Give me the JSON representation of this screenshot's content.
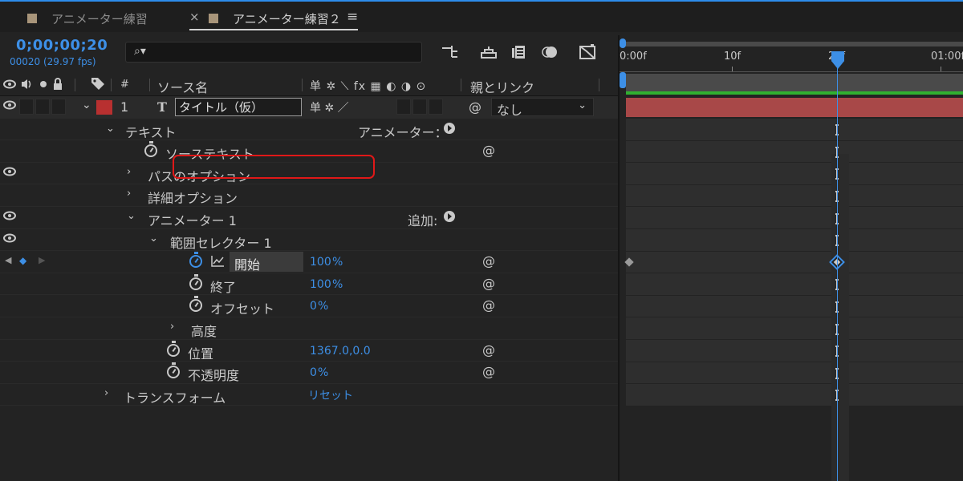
{
  "tabs": [
    {
      "label": "アニメーター練習",
      "active": false
    },
    {
      "label": "アニメーター練習２",
      "active": true
    }
  ],
  "tab_close": "×",
  "tab_menu": "≡",
  "time": {
    "timecode": "0;00;00;20",
    "frame_info": "00020 (29.97 fps)"
  },
  "search": {
    "icon": "⌕▾",
    "placeholder": "",
    "value": ""
  },
  "columns": {
    "number": "#",
    "source_name": "ソース名",
    "switches": "单 ✲ ⟍ fx ▦ ◐ ◑ ⊙",
    "parent_link": "親とリンク"
  },
  "layer": {
    "number": "1",
    "type_icon": "T",
    "name": "タイトル（仮）",
    "switches": "单 ✲ ／",
    "parent_value": "なし",
    "label_color": "#b83030"
  },
  "properties": {
    "text": "テキスト",
    "animator_label": "アニメーター：",
    "source_text": "ソーステキスト",
    "path_options": "パスのオプション",
    "more_options": "詳細オプション",
    "animator1": "アニメーター 1",
    "add_label": "追加:",
    "range_selector": "範囲セレクター 1",
    "start": "開始",
    "start_value": "100",
    "end": "終了",
    "end_value": "100",
    "offset": "オフセット",
    "offset_value": "0",
    "advanced": "高度",
    "position": "位置",
    "position_value": "1367.0,0.0",
    "opacity": "不透明度",
    "opacity_value": "0",
    "transform": "トランスフォーム",
    "reset": "リセット",
    "percent": "%"
  },
  "timeline": {
    "ruler_labels": [
      "0:00f",
      "10f",
      "20f",
      "01:00f"
    ],
    "accent": "#3d8fe6",
    "layer_bar_color": "#a84848"
  }
}
